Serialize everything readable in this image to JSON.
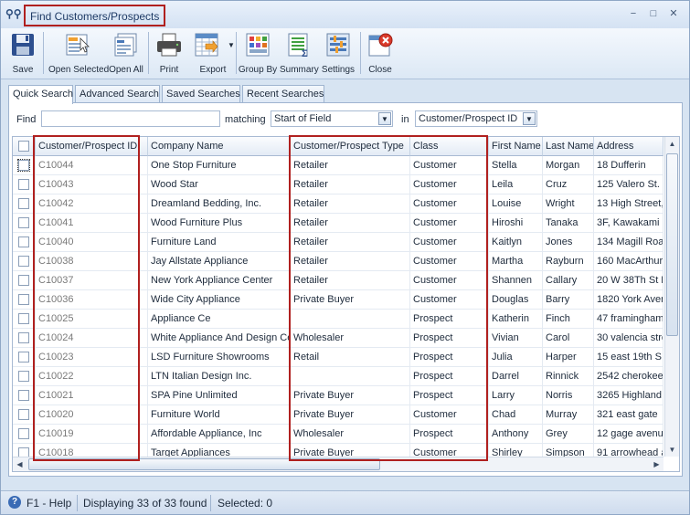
{
  "window": {
    "title": "Find Customers/Prospects",
    "min": "−",
    "max": "□",
    "close": "✕"
  },
  "toolbar": [
    {
      "label": "Save",
      "icon": "save-icon"
    },
    {
      "label": "Open Selected",
      "icon": "open-selected-icon"
    },
    {
      "label": "Open All",
      "icon": "open-all-icon"
    },
    {
      "label": "Print",
      "icon": "printer-icon"
    },
    {
      "label": "Export",
      "icon": "export-icon"
    },
    {
      "label": "Group By",
      "icon": "group-by-icon"
    },
    {
      "label": "Summary",
      "icon": "summary-icon"
    },
    {
      "label": "Settings",
      "icon": "settings-icon"
    },
    {
      "label": "Close",
      "icon": "close-icon"
    }
  ],
  "tabs": [
    "Quick Search",
    "Advanced Search",
    "Saved Searches",
    "Recent Searches"
  ],
  "find": {
    "label": "Find",
    "value": "",
    "matching_label": "matching",
    "matching_value": "Start of Field",
    "in_label": "in",
    "in_value": "Customer/Prospect ID"
  },
  "grid": {
    "columns": [
      "Customer/Prospect ID",
      "Company Name",
      "Customer/Prospect Type",
      "Class",
      "First Name",
      "Last Name",
      "Address"
    ],
    "rows": [
      [
        "C10044",
        "One Stop Furniture",
        "Retailer",
        "Customer",
        "Stella",
        "Morgan",
        "18 Dufferin"
      ],
      [
        "C10043",
        "Wood Star",
        "Retailer",
        "Customer",
        "Leila",
        "Cruz",
        "125 Valero St."
      ],
      [
        "C10042",
        "Dreamland Bedding, Inc.",
        "Retailer",
        "Customer",
        "Louise",
        "Wright",
        "13 High Street,"
      ],
      [
        "C10041",
        "Wood Furniture Plus",
        "Retailer",
        "Customer",
        "Hiroshi",
        "Tanaka",
        "3F, Kawakami B"
      ],
      [
        "C10040",
        "Furniture Land",
        "Retailer",
        "Customer",
        "Kaitlyn",
        "Jones",
        "134 Magill Road"
      ],
      [
        "C10038",
        "Jay Allstate Appliance",
        "Retailer",
        "Customer",
        "Martha",
        "Rayburn",
        "160 MacArthur"
      ],
      [
        "C10037",
        "New York Appliance Center",
        "Retailer",
        "Customer",
        "Shannen",
        "Callary",
        "20 W 38Th St F"
      ],
      [
        "C10036",
        "Wide City Appliance",
        "Private Buyer",
        "Customer",
        "Douglas",
        "Barry",
        "1820 York Aven"
      ],
      [
        "C10025",
        "Appliance Ce",
        "",
        "Prospect",
        "Katherin",
        "Finch",
        "47 framingham"
      ],
      [
        "C10024",
        "White Appliance And Design Cen",
        "Wholesaler",
        "Prospect",
        "Vivian",
        "Carol",
        "30 valencia stre"
      ],
      [
        "C10023",
        "LSD Furniture Showrooms",
        "Retail",
        "Prospect",
        "Julia",
        "Harper",
        "15 east 19th S"
      ],
      [
        "C10022",
        "LTN Italian Design Inc.",
        "",
        "Prospect",
        "Darrel",
        "Rinnick",
        "2542 cherokee"
      ],
      [
        "C10021",
        "SPA Pine Unlimited",
        "Private Buyer",
        "Prospect",
        "Larry",
        "Norris",
        "3265 Highland"
      ],
      [
        "C10020",
        "Furniture World",
        "Private Buyer",
        "Customer",
        "Chad",
        "Murray",
        "321 east gate"
      ],
      [
        "C10019",
        "Affordable Appliance, Inc",
        "Wholesaler",
        "Prospect",
        "Anthony",
        "Grey",
        "12 gage avenue"
      ],
      [
        "C10018",
        "Target Appliances",
        "Private Buyer",
        "Customer",
        "Shirley",
        "Simpson",
        "91 arrowhead a"
      ]
    ]
  },
  "status": {
    "help": "F1 - Help",
    "displaying": "Displaying 33 of 33 found",
    "selected": "Selected: 0"
  }
}
